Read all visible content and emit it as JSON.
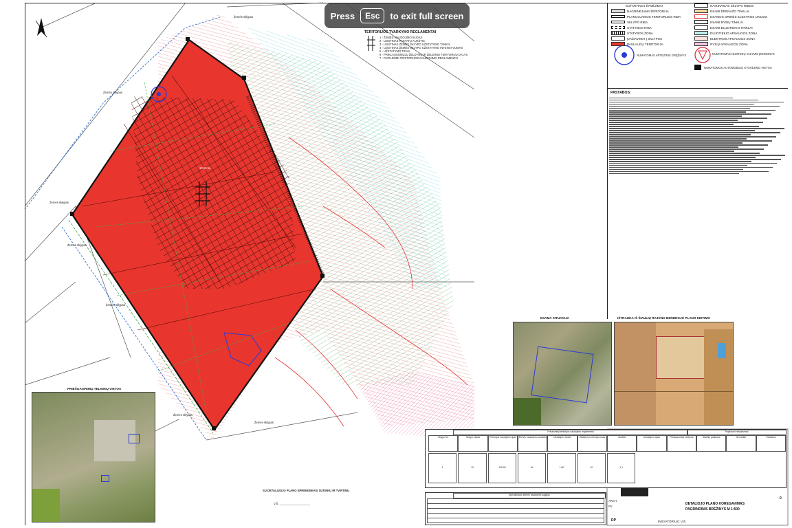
{
  "banner": {
    "press": "Press",
    "key": "Esc",
    "rest": "to exit full screen"
  },
  "legend": {
    "left": [
      {
        "label": "SUTARTINIAI ŽYMĖJIMAI",
        "color": "#ffffff"
      },
      {
        "label": "NAGRINĖJAMA TERITORIJA",
        "color": "#dddddd"
      },
      {
        "label": "PLANUOJAMOS TERITORIJOS RIBA",
        "color": "#ffffff"
      },
      {
        "label": "SKLYPO RIBA",
        "color": "#ffffff"
      },
      {
        "label": "STATYBOS RIBA",
        "color": "#ffffff"
      },
      {
        "label": "STATYBOS ZONA",
        "color": "#ffffff"
      },
      {
        "label": "ĮVAŽIAVIMAI Į SKLYPUS",
        "color": "#ffffff"
      },
      {
        "label": "PASLAUGŲ TERITORIJA",
        "color": "#e8392f"
      }
    ],
    "right": [
      {
        "label": "NAIKINAMAS SKLYPO RIBOS",
        "color": "#ffffff"
      },
      {
        "label": "ESAMI DRENAŽO TINKLAI",
        "color": "#f0d9a0"
      },
      {
        "label": "ESAMOS ORINĖS ELEKTROS LINIJOS",
        "color": "#ffffff"
      },
      {
        "label": "ESAMI RYŠIŲ TINKLAI",
        "color": "#ffffff"
      },
      {
        "label": "ESAMI DUJOTIEKIO TINKLAI",
        "color": "#ffffff"
      },
      {
        "label": "DUJOTIEKIO APSAUGOS ZONA",
        "color": "#bff0f0"
      },
      {
        "label": "ELEKTROS APSAUGOS ZONA",
        "color": "#ffe0e0"
      },
      {
        "label": "RYŠIŲ APSAUGOS ZONA",
        "color": "#f7c6e3"
      }
    ],
    "well": "NUMATOMAS ARTEZINIS GRĘŽINYS",
    "treatment": "NUMATOMAS NUOTEKŲ VALYMO ĮRENGINYS",
    "parking": "NUMATOMOS AUTOMOBILIŲ STOVĖJIMO VIETOS"
  },
  "regulation_block": {
    "title": "TERITORIJOS TVARKYMO REGLAMENTAI",
    "lines": [
      "1 - ŽEMĖS NAUDOJIMO BŪDAS",
      "2 - LEISTINAS PASTATŲ AUKŠTIS",
      "3 - LEISTINAS ŽEMĖS SKLYPO UŽSTATYMO TANKIS",
      "4 - LEISTINAS ŽEMĖS SKLYPO UŽSTATYMO INTENSYVUMAS",
      "5 - UŽSTATYMO TIPAS",
      "6 - PRIKLAUSOMŲJŲ ŽELDYNŲ IR ŽELDINIŲ TERITORIJŲ DALYS",
      "7 - PAPILDOMI TERITORIJOS NAUDOJIMO REGLAMENTAI"
    ]
  },
  "notes_title": "PASTABOS:",
  "notes_count": 38,
  "captions": {
    "existing": "ESAMA SITUACIJA",
    "extract": "IŠTRAUKA IŠ ŠIAULIŲ RAJONO BENDROJO PLANO KEITIMO",
    "wells": "PRIEŠGAISRINIŲ TELKINIŲ VIETOS",
    "agreed": "SU DETALIUOJO PLANO SPRENDINIAIS SUTINKU IR TVIRTINU",
    "vs": "V.Š. ___________________"
  },
  "table": {
    "top_header": "Privalomieji teritorijos naudojimo reglamentai",
    "top_header_right": "Papildomi reikalavimai",
    "columns": [
      "Sklypo Nr.",
      "Sklypo plotas",
      "Teritorijos naudojimo tipas",
      "Žemės naudojimo paskirtis",
      "Užstatymo tankis",
      "Užstatymo intensyvumas",
      "Aukštis",
      "Užstatymo tipas",
      "Priklausomieji želdynai",
      "Statinių paskirtys",
      "Servitutai",
      "Pastabos"
    ],
    "row_values": [
      "1",
      "12",
      "125,00",
      "44",
      "1,50",
      "10",
      "1,1"
    ],
    "spec_header": "Specialiosios žemės naudojimo sąlygos"
  },
  "stamp": {
    "title_1": "DETALIOJO PLANO KOREGAVIMAS",
    "title_2": "PAGRINDINIS BRĖŽINYS M 1:500",
    "stage": "DP",
    "sheet": "0",
    "author": "INICIATORIUS: V.Š.",
    "roles": [
      "ARCH.",
      "PV"
    ]
  },
  "map_labels": {
    "neighbour": "Žemės sklypas",
    "area_label": "10,50 ha"
  }
}
